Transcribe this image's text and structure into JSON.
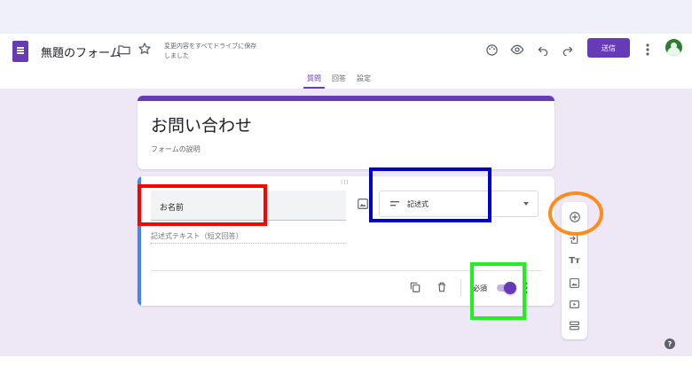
{
  "header": {
    "form_name": "無題のフォーム",
    "save_status": "変更内容をすべてドライブに保存しました",
    "send_label": "送信"
  },
  "tabs": [
    {
      "label": "質問",
      "active": true
    },
    {
      "label": "回答",
      "active": false
    },
    {
      "label": "設定",
      "active": false
    }
  ],
  "form": {
    "title": "お問い合わせ",
    "description": "フォームの説明"
  },
  "question": {
    "title": "お名前",
    "type": "記述式",
    "answer_placeholder": "記述式テキスト（短文回答）",
    "required_label": "必須",
    "required": true
  },
  "side_toolbar": {
    "tools": [
      "add-question-icon",
      "import-questions-icon",
      "add-title-icon",
      "add-image-icon",
      "add-video-icon",
      "add-section-icon"
    ]
  },
  "colors": {
    "accent": "#673ab7",
    "question_border": "#4285f4",
    "annotation_red": "#ff0000",
    "annotation_blue": "#0000cc",
    "annotation_green": "#22ee22",
    "annotation_orange": "#ff8c1a"
  }
}
